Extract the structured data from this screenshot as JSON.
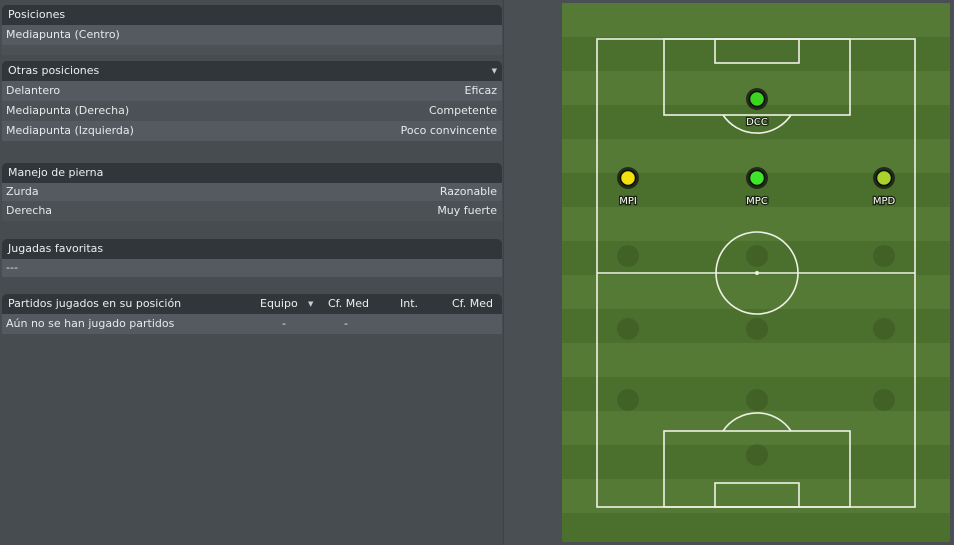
{
  "positions": {
    "title": "Posiciones",
    "rows": [
      {
        "label": "Mediapunta (Centro)"
      }
    ]
  },
  "other_positions": {
    "title": "Otras posiciones",
    "rows": [
      {
        "label": "Delantero",
        "value": "Eficaz"
      },
      {
        "label": "Mediapunta (Derecha)",
        "value": "Competente"
      },
      {
        "label": "Mediapunta (Izquierda)",
        "value": "Poco convincente"
      }
    ]
  },
  "foot": {
    "title": "Manejo de pierna",
    "rows": [
      {
        "label": "Zurda",
        "value": "Razonable"
      },
      {
        "label": "Derecha",
        "value": "Muy fuerte"
      }
    ]
  },
  "favorite_plays": {
    "title": "Jugadas favoritas",
    "value": "---"
  },
  "matches": {
    "title": "Partidos jugados en su posición",
    "columns": {
      "team": "Equipo",
      "rating1": "Cf. Med",
      "int": "Int.",
      "rating2": "Cf. Med"
    },
    "row": {
      "label": "Aún no se han jugado partidos",
      "team": "-",
      "rating1": "-"
    }
  },
  "pitch": {
    "colors": {
      "stripe_a": "#557a35",
      "stripe_b": "#4b6f2d",
      "line": "#eef2e6"
    },
    "players": [
      {
        "label": "DCC",
        "color": "#3bd421"
      },
      {
        "label": "MPI",
        "color": "#f2e10c"
      },
      {
        "label": "MPC",
        "color": "#3de62a"
      },
      {
        "label": "MPD",
        "color": "#a9d22a"
      }
    ]
  }
}
